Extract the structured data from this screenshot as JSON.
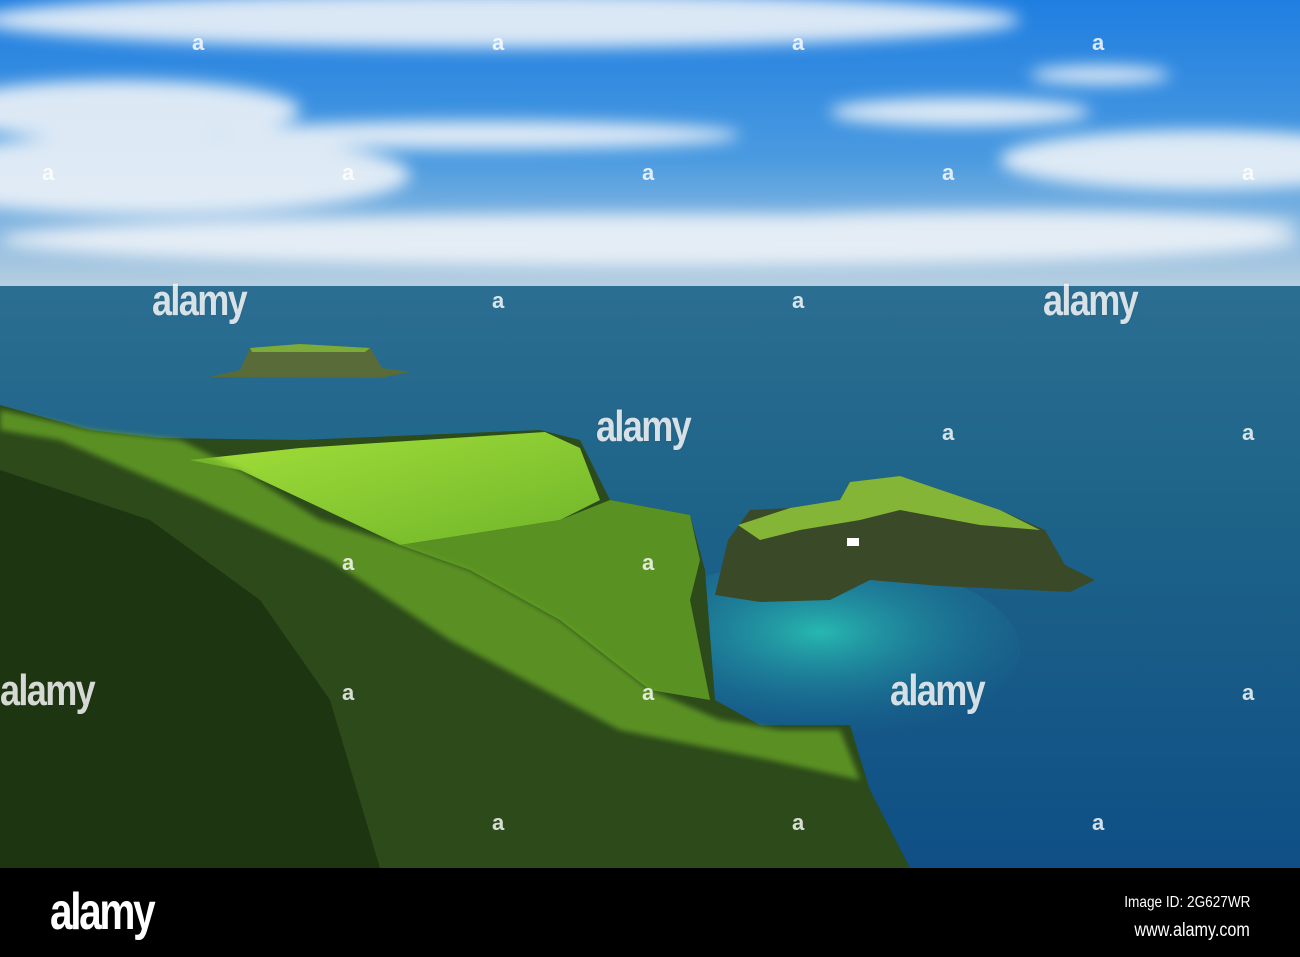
{
  "image": {
    "subject": "coastal cliffs and islands",
    "colors": {
      "sky": "#2f86d8",
      "sea": "#1a5f86",
      "lagoon": "#1aa3a8",
      "grass": "#8fd12e",
      "cliff_shadow": "#243a16"
    }
  },
  "watermark": {
    "logo": "alamy",
    "small": "a"
  },
  "footer": {
    "logo": "alamy",
    "image_id": "Image ID: 2G627WR",
    "url": "www.alamy.com"
  }
}
